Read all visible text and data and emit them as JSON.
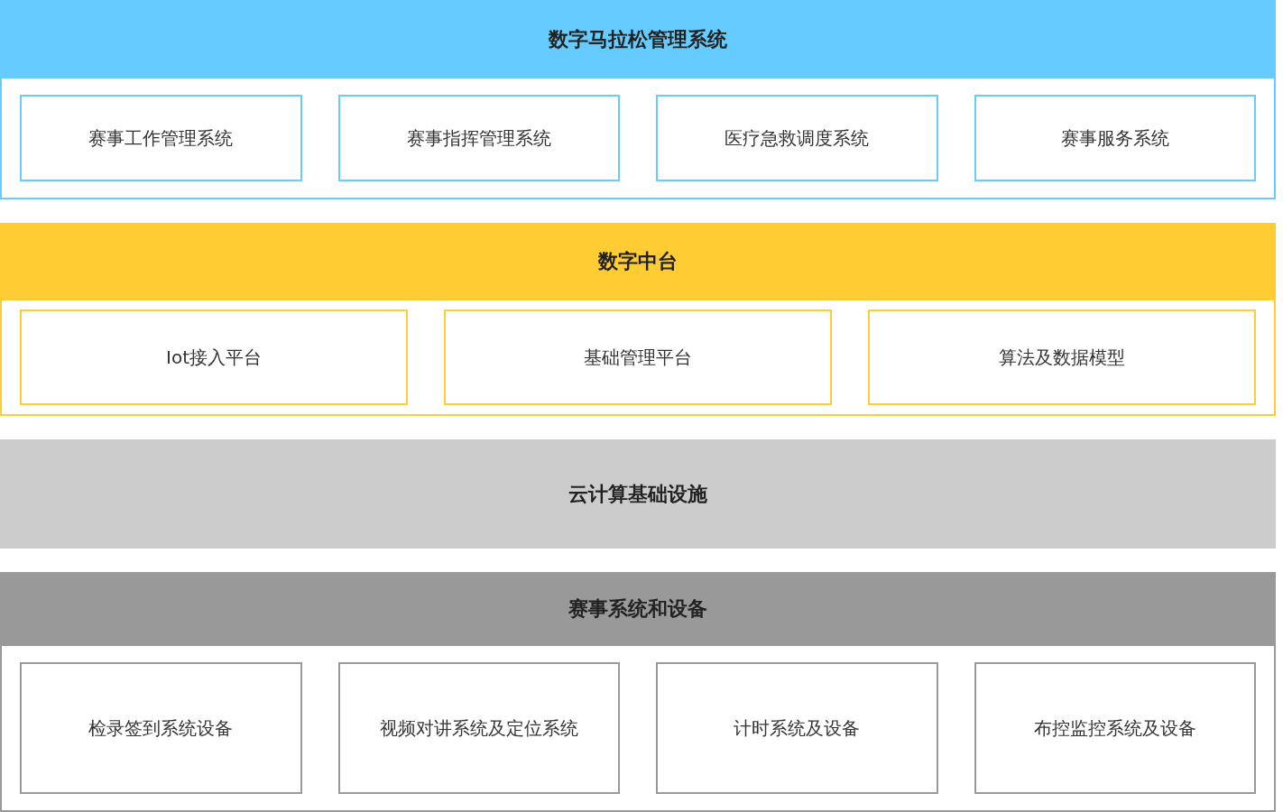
{
  "layers": [
    {
      "title": "数字马拉松管理系统",
      "color": "#66ccff",
      "items": [
        "赛事工作管理系统",
        "赛事指挥管理系统",
        "医疗急救调度系统",
        "赛事服务系统"
      ]
    },
    {
      "title": "数字中台",
      "color": "#ffcc33",
      "items": [
        "Iot接入平台",
        "基础管理平台",
        "算法及数据模型"
      ]
    },
    {
      "title": "云计算基础设施",
      "color": "#cccccc"
    },
    {
      "title": "赛事系统和设备",
      "color": "#999999",
      "items": [
        "检录签到系统设备",
        "视频对讲系统及定位系统",
        "计时系统及设备",
        "布控监控系统及设备"
      ]
    }
  ]
}
